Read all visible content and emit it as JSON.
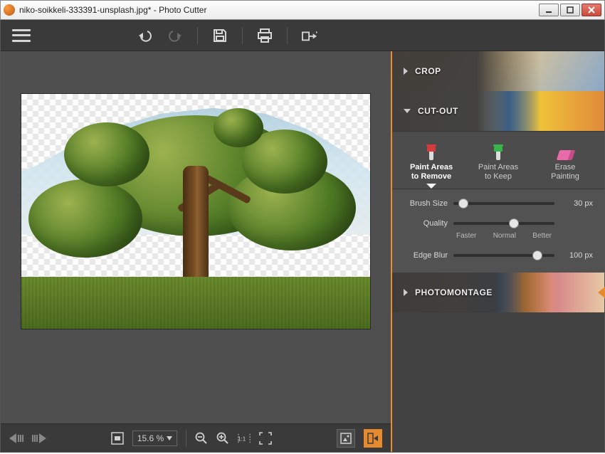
{
  "window": {
    "title": "niko-soikkeli-333391-unsplash.jpg* - Photo Cutter"
  },
  "sections": {
    "crop": "CROP",
    "cutout": "CUT-OUT",
    "photomontage": "PHOTOMONTAGE"
  },
  "tools": {
    "remove": {
      "line1": "Paint Areas",
      "line2": "to Remove",
      "color": "#d63a3a"
    },
    "keep": {
      "line1": "Paint Areas",
      "line2": "to Keep",
      "color": "#35b54a"
    },
    "erase": {
      "line1": "Erase",
      "line2": "Painting"
    }
  },
  "sliders": {
    "brush": {
      "label": "Brush Size",
      "value_text": "30 px",
      "value": 30,
      "min": 0,
      "max": 300
    },
    "quality": {
      "label": "Quality",
      "ticks": {
        "low": "Faster",
        "mid": "Normal",
        "high": "Better"
      },
      "value": 60,
      "min": 0,
      "max": 100
    },
    "edge": {
      "label": "Edge Blur",
      "value_text": "100 px",
      "value": 100,
      "min": 0,
      "max": 120
    }
  },
  "bottombar": {
    "zoom_text": "15.6 %"
  }
}
